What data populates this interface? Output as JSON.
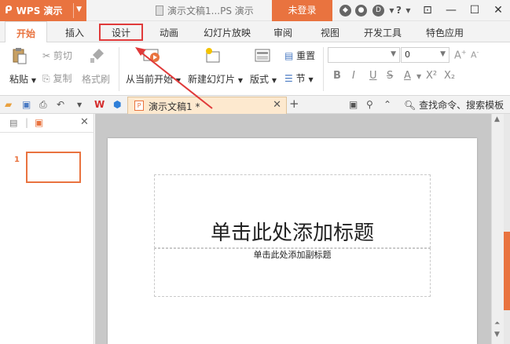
{
  "titlebar": {
    "app_name": "WPS 演示",
    "doc_title": "演示文稿1...PS 演示",
    "login_label": "未登录",
    "help_label": "?",
    "controls": [
      "⊡",
      "—",
      "☐",
      "✕"
    ]
  },
  "tabs": [
    {
      "label": "开始",
      "active": true
    },
    {
      "label": "插入"
    },
    {
      "label": "设计"
    },
    {
      "label": "动画"
    },
    {
      "label": "幻灯片放映"
    },
    {
      "label": "审阅"
    },
    {
      "label": "视图"
    },
    {
      "label": "开发工具"
    },
    {
      "label": "特色应用"
    }
  ],
  "ribbon": {
    "paste": "粘贴",
    "cut": "剪切",
    "copy": "复制",
    "format_painter": "格式刷",
    "from_current": "从当前开始",
    "new_slide": "新建幻灯片",
    "layout": "版式",
    "reset": "重置",
    "section": "节",
    "font_size_value": "0",
    "format_buttons": [
      "B",
      "I",
      "U",
      "S",
      "A",
      "X²",
      "X₂"
    ]
  },
  "quickbar": {
    "doc_tab": "演示文稿1 *",
    "add_tab": "+",
    "search": "查找命令、搜索模板"
  },
  "slides_panel": {
    "slide_number": "1"
  },
  "slide": {
    "title_placeholder": "单击此处添加标题",
    "subtitle_placeholder": "单击此处添加副标题"
  },
  "colors": {
    "accent": "#e9733f",
    "highlight": "#e03a3a"
  }
}
